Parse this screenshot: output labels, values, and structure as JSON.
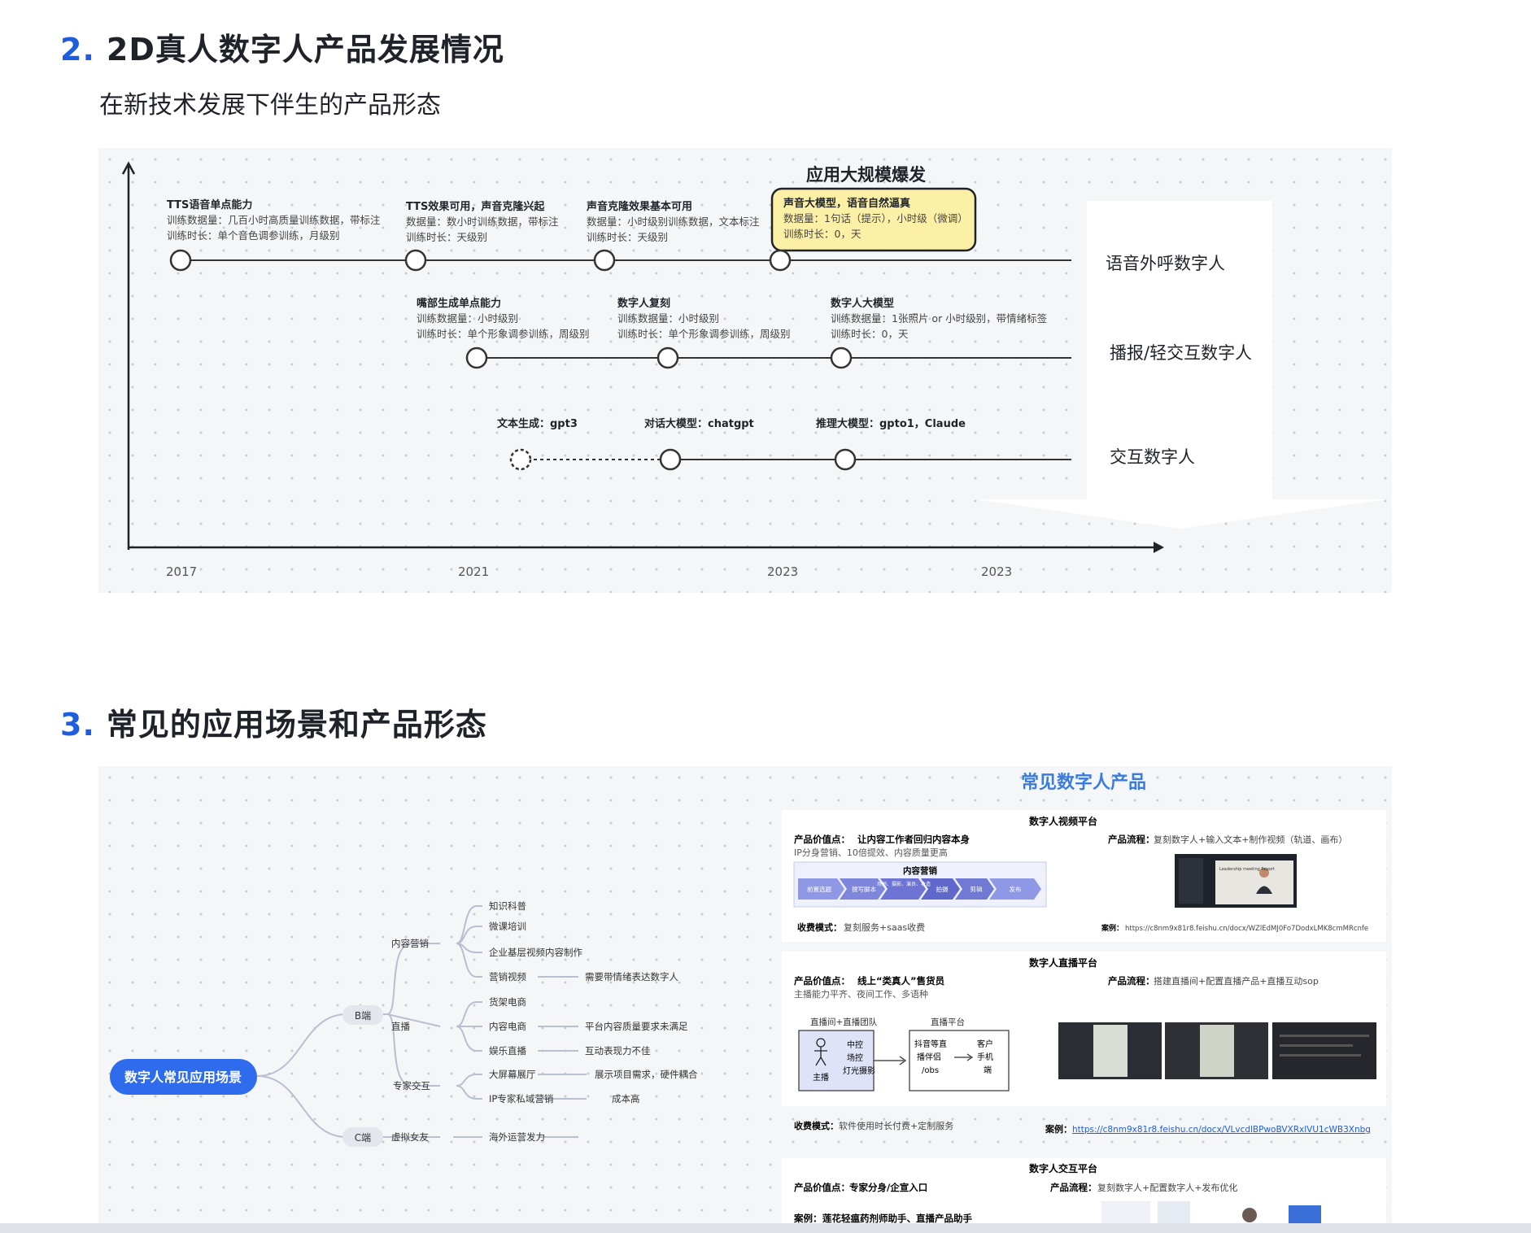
{
  "section2": {
    "number": "2.",
    "title": "2D真人数字人产品发展情况",
    "subtitle": "在新技术发展下伴生的产品形态",
    "timeline": {
      "highlight_label": "应用大规模爆发",
      "rows": [
        {
          "label": "语音外呼数字人",
          "nodes": [
            {
              "title": "TTS语音单点能力",
              "lines": [
                "训练数据量：几百小时高质量训练数据，带标注",
                "训练时长：单个音色调参训练，月级别"
              ]
            },
            {
              "title": "TTS效果可用，声音克隆兴起",
              "lines": [
                "数据量：数小时训练数据，带标注",
                "训练时长：天级别"
              ]
            },
            {
              "title": "声音克隆效果基本可用",
              "lines": [
                "数据量：小时级别训练数据，文本标注",
                "训练时长：天级别"
              ]
            },
            {
              "title": "声音大模型，语音自然逼真",
              "lines": [
                "数据量：1句话（提示），小时级（微调）",
                "训练时长：0，天"
              ]
            }
          ]
        },
        {
          "label": "播报/轻交互数字人",
          "nodes": [
            {
              "title": "嘴部生成单点能力",
              "lines": [
                "训练数据量：小时级别",
                "训练时长：单个形象调参训练，周级别"
              ]
            },
            {
              "title": "数字人复刻",
              "lines": [
                "训练数据量：小时级别",
                "训练时长：单个形象调参训练，周级别"
              ]
            },
            {
              "title": "数字人大模型",
              "lines": [
                "训练数据量：1张照片 or 小时级别，带情绪标签",
                "训练时长：0，天"
              ]
            }
          ]
        },
        {
          "label": "交互数字人",
          "nodes": [
            {
              "title": "文本生成：gpt3",
              "lines": []
            },
            {
              "title": "对话大模型：chatgpt",
              "lines": []
            },
            {
              "title": "推理大模型：gpto1，Claude",
              "lines": []
            }
          ]
        }
      ],
      "years": [
        "2017",
        "2021",
        "2023",
        "2023"
      ]
    }
  },
  "section3": {
    "number": "3.",
    "title": "常见的应用场景和产品形态",
    "mindmap": {
      "root": "数字人常见应用场景",
      "b_end": "B端",
      "c_end": "C端",
      "categories": [
        "内容营销",
        "直播",
        "专家交互",
        "虚拟女友"
      ],
      "leaves": [
        "知识科普",
        "微课培训",
        "企业基层视频内容制作",
        "营销视频",
        "货架电商",
        "内容电商",
        "娱乐直播",
        "大屏幕展厅",
        "IP专家私域营销",
        "海外运营发力"
      ],
      "notes": [
        "需要带情绪表达数字人",
        "平台内容质量要求未满足",
        "互动表现力不佳",
        "展示项目需求，硬件耦合",
        "成本高"
      ]
    },
    "products": {
      "title": "常见数字人产品",
      "video_platform": {
        "name": "数字人视频平台",
        "value_label": "产品价值点：",
        "value": "让内容工作者回归内容本身",
        "value_sub": "IP分身营销、10倍提效、内容质量更高",
        "flow_label": "产品流程：",
        "flow": "复刻数字人+输入文本+制作视频（轨道、画布）",
        "diagram_title": "内容营销",
        "diagram_steps": [
          "前置选题",
          "撰写脚本",
          "场地、摄影、演员、妆造",
          "拍摄",
          "剪辑",
          "发布"
        ],
        "screenshot_text": "Leadership meeting Report",
        "fee_label": "收费模式：",
        "fee": "复刻服务+saas收费",
        "case_label": "案例：",
        "case": "https://c8nm9x81r8.feishu.cn/docx/WZlEdMJ0Fo7DodxLMK8cmMRcnfe"
      },
      "live_platform": {
        "name": "数字人直播平台",
        "value_label": "产品价值点：",
        "value": "线上“类真人”售货员",
        "value_sub": "主播能力平齐、夜间工作、多语种",
        "flow_label": "产品流程：",
        "flow": "搭建直播间+配置直播产品+直播互动sop",
        "team_title": "直播间+直播团队",
        "team_items": [
          "中控",
          "场控",
          "灯光摄影"
        ],
        "host": "主播",
        "platform_title": "直播平台",
        "platform_items": [
          "抖音等直",
          "播伴侣",
          "/obs"
        ],
        "client_items": [
          "客户",
          "手机",
          "端"
        ],
        "fee_label": "收费模式：",
        "fee": "软件使用时长付费+定制服务",
        "case_label": "案例：",
        "case": "https://c8nm9x81r8.feishu.cn/docx/VLvcdlBPwoBVXRxlVU1cWB3Xnbg"
      },
      "interact_platform": {
        "name": "数字人交互平台",
        "value_label": "产品价值点：",
        "value": "专家分身/企宣入口",
        "flow_label": "产品流程：",
        "flow": "复刻数字人+配置数字人+发布优化",
        "case_label": "案例：",
        "case": "莲花轻瘟药剂师助手、直播产品助手"
      }
    }
  },
  "colors": {
    "accent": "#1f5de0",
    "root_node": "#2f6bed",
    "highlight_fill": "#fcf0a7",
    "board_bg": "#f5f6f7",
    "link": "#1f5de0"
  }
}
